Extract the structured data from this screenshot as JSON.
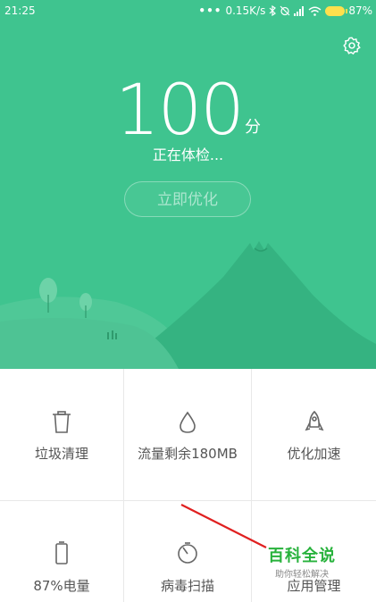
{
  "status_bar": {
    "time": "21:25",
    "dots": "•••",
    "network_speed": "0.15K/s",
    "battery_percent": "87%"
  },
  "hero": {
    "score": "100",
    "score_unit": "分",
    "checking_text": "正在体检...",
    "optimize_button": "立即优化",
    "background_color": "#3fc48f"
  },
  "grid": {
    "items": [
      {
        "label": "垃圾清理",
        "icon": "trash-icon"
      },
      {
        "label": "流量剩余180MB",
        "icon": "water-drop-icon"
      },
      {
        "label": "优化加速",
        "icon": "rocket-icon"
      },
      {
        "label": "87%电量",
        "icon": "battery-icon"
      },
      {
        "label": "病毒扫描",
        "icon": "virus-scan-icon"
      },
      {
        "label": "应用管理",
        "icon": "app-manage-icon"
      }
    ]
  },
  "watermark": {
    "title": "百科全说",
    "subtitle": "助你轻松解决",
    "color": "#28b23c"
  },
  "annotation": {
    "arrow_color": "#e02020"
  }
}
